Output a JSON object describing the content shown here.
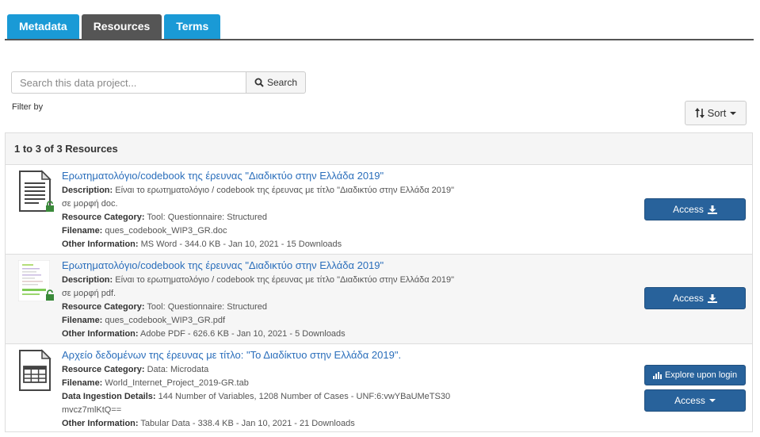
{
  "tabs": [
    {
      "label": "Metadata"
    },
    {
      "label": "Resources"
    },
    {
      "label": "Terms"
    }
  ],
  "search": {
    "placeholder": "Search this data project...",
    "button_label": "Search",
    "filter_label": "Filter by",
    "sort_label": "Sort"
  },
  "results": {
    "header": "1 to 3 of 3 Resources"
  },
  "resources": [
    {
      "title": "Ερωτηματολόγιο/codebook της έρευνας \"Διαδικτύο στην Ελλάδα 2019\"",
      "description_label": "Description:",
      "description_line1": "Είναι το ερωτηματολόγιο / codebook της έρευνας με τίτλο \"Διαδικτύο στην Ελλάδα 2019\"",
      "description_line2": "σε μορφή doc.",
      "category_label": "Resource Category:",
      "category": "Tool: Questionnaire: Structured",
      "filename_label": "Filename:",
      "filename": "ques_codebook_WIP3_GR.doc",
      "other_label": "Other Information:",
      "other": "MS Word - 344.0 KB - Jan 10, 2021 - 15 Downloads",
      "access_label": "Access",
      "icon": "document-icon"
    },
    {
      "title": "Ερωτηματολόγιο/codebook της έρευνας \"Διαδικτύο στην Ελλάδα 2019\"",
      "description_label": "Description:",
      "description_line1": "Είναι το ερωτηματολόγιο / codebook της έρευνας με τίτλο \"Διαδικτύο στην Ελλάδα 2019\"",
      "description_line2": "σε μορφή pdf.",
      "category_label": "Resource Category:",
      "category": "Tool: Questionnaire: Structured",
      "filename_label": "Filename:",
      "filename": "ques_codebook_WIP3_GR.pdf",
      "other_label": "Other Information:",
      "other": "Adobe PDF - 626.6 KB - Jan 10, 2021 - 5 Downloads",
      "access_label": "Access",
      "icon": "pdf-thumbnail"
    },
    {
      "title": "Αρχείο δεδομένων της έρευνας με τίτλο: \"Το Διαδίκτυο στην Ελλάδα 2019\".",
      "category_label": "Resource Category:",
      "category": "Data: Microdata",
      "filename_label": "Filename:",
      "filename": "World_Internet_Project_2019-GR.tab",
      "ingestion_label": "Data Ingestion Details:",
      "ingestion_line1": "144 Number of Variables, 1208 Number of Cases - UNF:6:vwYBaUMeTS30",
      "ingestion_line2": "mvcz7mlKtQ==",
      "other_label": "Other Information:",
      "other": "Tabular Data - 338.4 KB - Jan 10, 2021 - 21 Downloads",
      "explore_label": "Explore upon login",
      "access_label": "Access",
      "icon": "tabular-file-icon"
    }
  ],
  "colors": {
    "tab_blue": "#1a9ad6",
    "tab_active": "#555555",
    "link": "#2a6ebb",
    "button_primary": "#28629b",
    "lock_green": "#3a8a3a"
  }
}
